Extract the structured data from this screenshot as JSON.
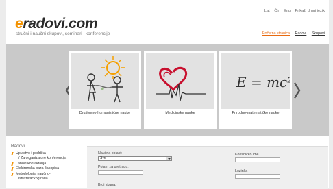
{
  "languages": [
    "Lat",
    "Ćir",
    "Eng",
    "Prikaži drugi jezik"
  ],
  "logo": {
    "accent_letter": "e",
    "rest": "radovi.com"
  },
  "tagline": "stručni i naučni skupovi, seminari i konferencije",
  "top_nav": [
    {
      "label": "Početna stranica",
      "active": true
    },
    {
      "label": "Radovi",
      "active": false
    },
    {
      "label": "Skupovi",
      "active": false
    }
  ],
  "carousel": {
    "cards": [
      {
        "label": "Društveno-humanistične nauke",
        "icon": "children-sun-drawing"
      },
      {
        "label": "Medicinske nauke",
        "icon": "heart-pulse-drawing"
      },
      {
        "label": "Prirodno-matematičke nauke",
        "icon": "formula-drawing",
        "formula": "E = mc²"
      }
    ]
  },
  "sidebar": {
    "title": "Radovi",
    "items": [
      {
        "label": "Uputstvo i podrška",
        "sub": false
      },
      {
        "label": "/ Za organizatore konferencija",
        "sub": true
      },
      {
        "label": "Lanovi kontaktanja",
        "sub": false
      },
      {
        "label": "Elektronska baza časopisa",
        "sub": false
      },
      {
        "label": "Metodologija naučno-",
        "sub": false
      },
      {
        "label": "istraživačkog rada",
        "sub": true
      }
    ]
  },
  "search_form": {
    "field_label": "Naučna oblast:",
    "field_value": "Sve",
    "term_label": "Pojam za pretragu:",
    "term_value": "",
    "group_label": "Broj skupa:"
  },
  "login_form": {
    "username_label": "Korisničko ime :",
    "password_label": "Lozinka :"
  },
  "colors": {
    "accent": "#f39200",
    "active_link": "#e86a10",
    "band": "#c9c9c9"
  }
}
